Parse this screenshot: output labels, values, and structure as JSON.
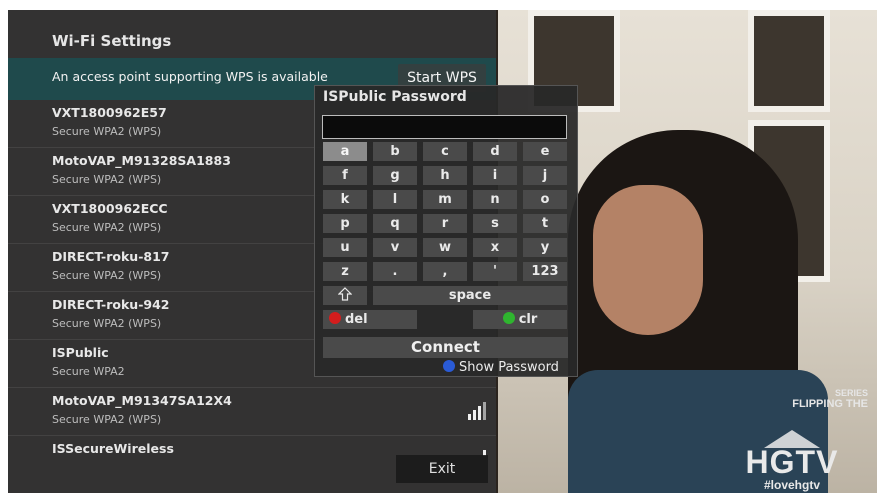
{
  "wifi": {
    "title": "Wi-Fi Settings",
    "wps_message": "An access point supporting WPS is available",
    "start_wps_label": "Start WPS",
    "networks": [
      {
        "name": "VXT1800962E57",
        "security": "Secure WPA2 (WPS)"
      },
      {
        "name": "MotoVAP_M91328SA1883",
        "security": "Secure WPA2 (WPS)"
      },
      {
        "name": "VXT1800962ECC",
        "security": "Secure WPA2 (WPS)"
      },
      {
        "name": "DIRECT-roku-817",
        "security": "Secure WPA2 (WPS)"
      },
      {
        "name": "DIRECT-roku-942",
        "security": "Secure WPA2 (WPS)"
      },
      {
        "name": "ISPublic",
        "security": "Secure WPA2"
      },
      {
        "name": "MotoVAP_M91347SA12X4",
        "security": "Secure WPA2 (WPS)",
        "icon": "signal-strength-icon"
      },
      {
        "name": "ISSecureWireless",
        "security": "",
        "icon": "signal-strength-icon"
      }
    ],
    "exit_label": "Exit"
  },
  "keyboard": {
    "title": "ISPublic Password",
    "input_value": "",
    "rows": [
      [
        "a",
        "b",
        "c",
        "d",
        "e"
      ],
      [
        "f",
        "g",
        "h",
        "i",
        "j"
      ],
      [
        "k",
        "l",
        "m",
        "n",
        "o"
      ],
      [
        "p",
        "q",
        "r",
        "s",
        "t"
      ],
      [
        "u",
        "v",
        "w",
        "x",
        "y"
      ],
      [
        "z",
        ".",
        ",",
        "'",
        "123"
      ]
    ],
    "selected_key": "a",
    "shift_icon": "shift-arrow-icon",
    "space_label": "space",
    "del_label": "del",
    "clr_label": "clr",
    "connect_label": "Connect",
    "show_password_label": "Show Password",
    "colors": {
      "del_dot": "#d41d1d",
      "clr_dot": "#2fb52f",
      "show_pw_dot": "#2a5bd6"
    }
  },
  "overlay": {
    "series_line1": "SERIES",
    "series_line2": "FLIPPING THE",
    "logo_text": "HGTV",
    "logo_tag": "#lovehgtv"
  }
}
